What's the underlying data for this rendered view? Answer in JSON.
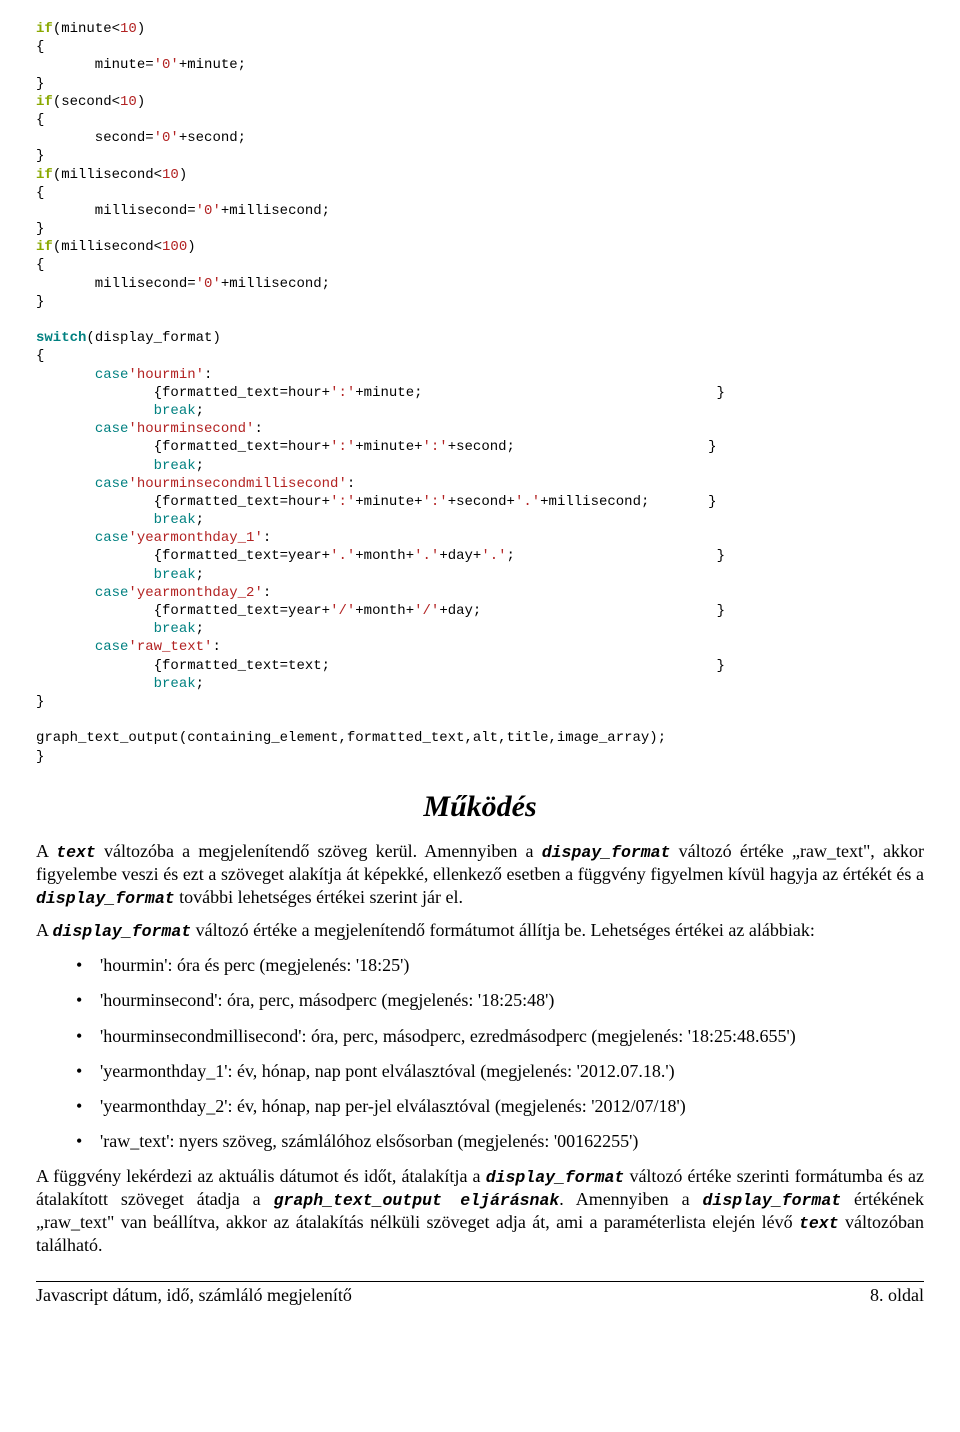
{
  "code": {
    "l01": "if",
    "l01b": "(minute<",
    "l01c": "10",
    "l01d": ")",
    "l02": "{",
    "l03": "       minute=",
    "l03b": "'0'",
    "l03c": "+minute;",
    "l04": "}",
    "l05": "if",
    "l05b": "(second<",
    "l05c": "10",
    "l05d": ")",
    "l06": "{",
    "l07": "       second=",
    "l07b": "'0'",
    "l07c": "+second;",
    "l08": "}",
    "l09": "if",
    "l09b": "(millisecond<",
    "l09c": "10",
    "l09d": ")",
    "l10": "{",
    "l11": "       millisecond=",
    "l11b": "'0'",
    "l11c": "+millisecond;",
    "l12": "}",
    "l13": "if",
    "l13b": "(millisecond<",
    "l13c": "100",
    "l13d": ")",
    "l14": "{",
    "l15": "       millisecond=",
    "l15b": "'0'",
    "l15c": "+millisecond;",
    "l16": "}",
    "l17": "",
    "l18": "switch",
    "l18b": "(display_format)",
    "l19": "{",
    "l20a": "       ",
    "l20": "case",
    "l20b": "'hourmin'",
    "l20c": ":",
    "l21": "              {formatted_text=hour+",
    "l21b": "':'",
    "l21c": "+minute;",
    "l21d": "                                   }",
    "l22a": "              ",
    "l22": "break",
    "l22b": ";",
    "l23a": "       ",
    "l23": "case",
    "l23b": "'hourminsecond'",
    "l23c": ":",
    "l24": "              {formatted_text=hour+",
    "l24b": "':'",
    "l24c": "+minute+",
    "l24d": "':'",
    "l24e": "+second;",
    "l24f": "                       }",
    "l25a": "              ",
    "l25": "break",
    "l25b": ";",
    "l26a": "       ",
    "l26": "case",
    "l26b": "'hourminsecondmillisecond'",
    "l26c": ":",
    "l27": "              {formatted_text=hour+",
    "l27b": "':'",
    "l27c": "+minute+",
    "l27d": "':'",
    "l27e": "+second+",
    "l27f": "'.'",
    "l27g": "+millisecond;",
    "l27h": "       }",
    "l28a": "              ",
    "l28": "break",
    "l28b": ";",
    "l29a": "       ",
    "l29": "case",
    "l29b": "'yearmonthday_1'",
    "l29c": ":",
    "l30": "              {formatted_text=year+",
    "l30b": "'.'",
    "l30c": "+month+",
    "l30d": "'.'",
    "l30e": "+day+",
    "l30f": "'.'",
    "l30g": ";",
    "l30h": "                        }",
    "l31a": "              ",
    "l31": "break",
    "l31b": ";",
    "l32a": "       ",
    "l32": "case",
    "l32b": "'yearmonthday_2'",
    "l32c": ":",
    "l33": "              {formatted_text=year+",
    "l33b": "'/'",
    "l33c": "+month+",
    "l33d": "'/'",
    "l33e": "+day;",
    "l33f": "                            }",
    "l34a": "              ",
    "l34": "break",
    "l34b": ";",
    "l35a": "       ",
    "l35": "case",
    "l35b": "'raw_text'",
    "l35c": ":",
    "l36": "              {formatted_text=text;",
    "l36b": "                                              }",
    "l37a": "              ",
    "l37": "break",
    "l37b": ";",
    "l38": "}",
    "l39": "",
    "l40": "graph_text_output(containing_element,formatted_text,alt,title,image_array);",
    "l41": "}"
  },
  "title": "Működés",
  "p1a": "A ",
  "p1_code1": "text",
  "p1b": " változóba a megjelenítendő szöveg kerül. Amennyiben a ",
  "p1_code2": "dispay_format",
  "p1c": " változó értéke „raw_text\", akkor figyelembe veszi és ezt a szöveget alakítja át képekké, ellenkező esetben a függvény figyelmen kívül hagyja az értékét és a ",
  "p1_code3": "display_format",
  "p1d": " további lehetséges értékei szerint jár el.",
  "p2a": "A ",
  "p2_code1": "display_format",
  "p2b": " változó értéke a megjelenítendő formátumot állítja be. Lehetséges értékei az alábbiak:",
  "bullets": [
    "'hourmin': óra és perc (megjelenés: '18:25')",
    "'hourminsecond': óra, perc, másodperc (megjelenés: '18:25:48')",
    "'hourminsecondmillisecond': óra, perc, másodperc, ezredmásodperc (megjelenés: '18:25:48.655')",
    "'yearmonthday_1': év, hónap, nap pont elválasztóval (megjelenés: '2012.07.18.')",
    "'yearmonthday_2': év, hónap, nap per-jel elválasztóval (megjelenés: '2012/07/18')",
    "'raw_text': nyers szöveg, számlálóhoz elsősorban (megjelenés: '00162255')"
  ],
  "p3a": "A függvény lekérdezi az aktuális dátumot és időt, átalakítja a ",
  "p3_code1": "display_format",
  "p3b": " változó értéke szerinti formátumba és az átalakított szöveget átadja a ",
  "p3_code2": "graph_text_output eljárásnak",
  "p3c": ". Amennyiben a ",
  "p3_code3": "display_format",
  "p3d": " értékének „raw_text\" van beállítva, akkor az átalakítás nélküli szöveget adja át, ami a paraméterlista elején lévő ",
  "p3_code4": "text",
  "p3e": " változóban található.",
  "footer_left": "Javascript dátum, idő, számláló megjelenítő",
  "footer_right": "8. oldal"
}
